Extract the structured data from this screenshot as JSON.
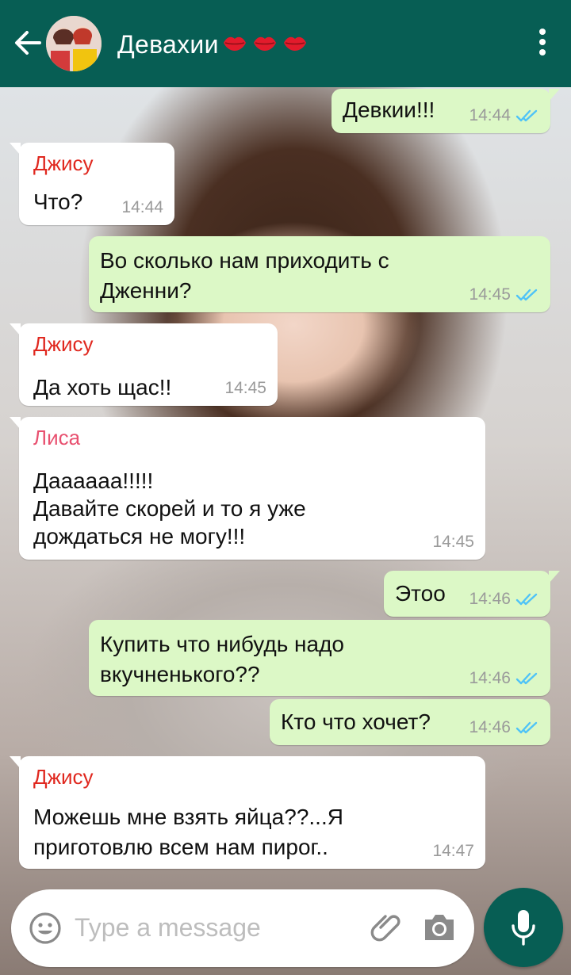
{
  "colors": {
    "header": "#075e54",
    "outgoing_bubble": "#dcf8c6",
    "incoming_bubble": "#ffffff",
    "read_ticks": "#4fc3f7",
    "jisoo_name": "#e0281f",
    "lisa_name": "#e8506f"
  },
  "header": {
    "title": "Девахии",
    "title_decor": [
      "lips-icon",
      "lips-icon",
      "lips-icon"
    ]
  },
  "messages": [
    {
      "direction": "out",
      "text": "Девкии!!!",
      "time": "14:44",
      "status": "read"
    },
    {
      "direction": "in",
      "sender": "Джису",
      "text": "Что?",
      "time": "14:44"
    },
    {
      "direction": "out",
      "lines": [
        "Во сколько нам приходить с",
        "Дженни?"
      ],
      "time": "14:45",
      "status": "read"
    },
    {
      "direction": "in",
      "sender": "Джису",
      "text": "Да хоть щас!!",
      "time": "14:45"
    },
    {
      "direction": "in",
      "sender": "Лиса",
      "lines": [
        "Даааааа!!!!!",
        "Давайте скорей и то я уже",
        "дождаться не могу!!!"
      ],
      "time": "14:45"
    },
    {
      "direction": "out",
      "text": "Этоо",
      "time": "14:46",
      "status": "read"
    },
    {
      "direction": "out",
      "lines": [
        "Купить что нибудь надо",
        "вкучненького??"
      ],
      "time": "14:46",
      "status": "read"
    },
    {
      "direction": "out",
      "text": "Кто что хочет?",
      "time": "14:46",
      "status": "read"
    },
    {
      "direction": "in",
      "sender": "Джису",
      "lines": [
        "Можешь мне взять яйца??...Я",
        "приготовлю всем нам пирог.."
      ],
      "time": "14:47"
    }
  ],
  "composer": {
    "placeholder": "Type a message",
    "icons": [
      "emoji-icon",
      "attach-icon",
      "camera-icon",
      "mic-icon"
    ]
  }
}
